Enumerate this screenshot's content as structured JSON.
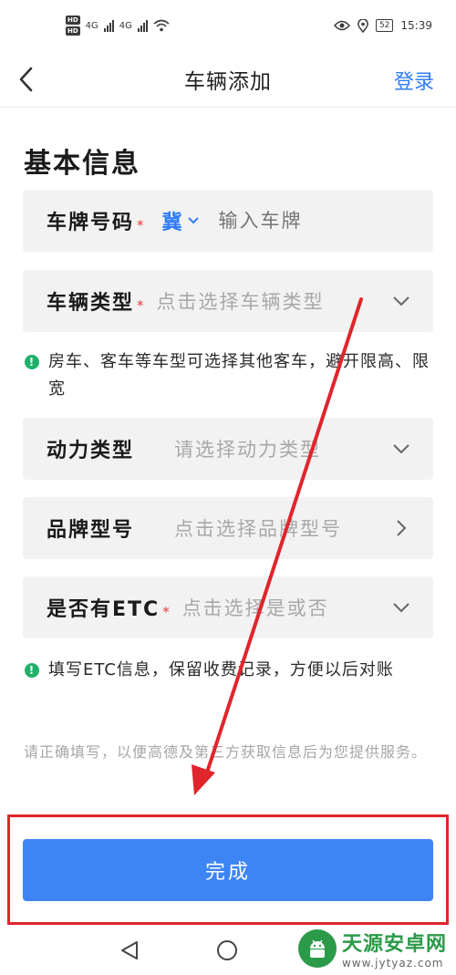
{
  "status_bar": {
    "hd_top": "HD",
    "hd_bottom": "HD",
    "net1": "4G",
    "net2": "4G",
    "battery": "52",
    "time": "15:39"
  },
  "header": {
    "title": "车辆添加",
    "login": "登录"
  },
  "section": {
    "title": "基本信息"
  },
  "form": {
    "plate": {
      "label": "车牌号码",
      "required": "*",
      "province": "冀",
      "placeholder": "输入车牌"
    },
    "vehicle_type": {
      "label": "车辆类型",
      "required": "*",
      "placeholder": "点击选择车辆类型"
    },
    "power_type": {
      "label": "动力类型",
      "placeholder": "请选择动力类型"
    },
    "brand_model": {
      "label": "品牌型号",
      "placeholder": "点击选择品牌型号"
    },
    "etc": {
      "label": "是否有ETC",
      "required": "*",
      "placeholder": "点击选择是或否"
    }
  },
  "hints": {
    "vehicle_type": "房车、客车等车型可选择其他客车，避开限高、限宽",
    "etc": "填写ETC信息，保留收费记录，方便以后对账"
  },
  "note": "请正确填写，以便高德及第三方获取信息后为您提供服务。",
  "done_button": "完成",
  "watermark": {
    "name": "天源安卓网",
    "url": "www.jytyaz.com"
  },
  "colors": {
    "accent": "#2f7cf6",
    "button": "#3d85f5",
    "required": "#e53935",
    "hint_icon": "#21b06a",
    "annotation": "#e0252c"
  }
}
